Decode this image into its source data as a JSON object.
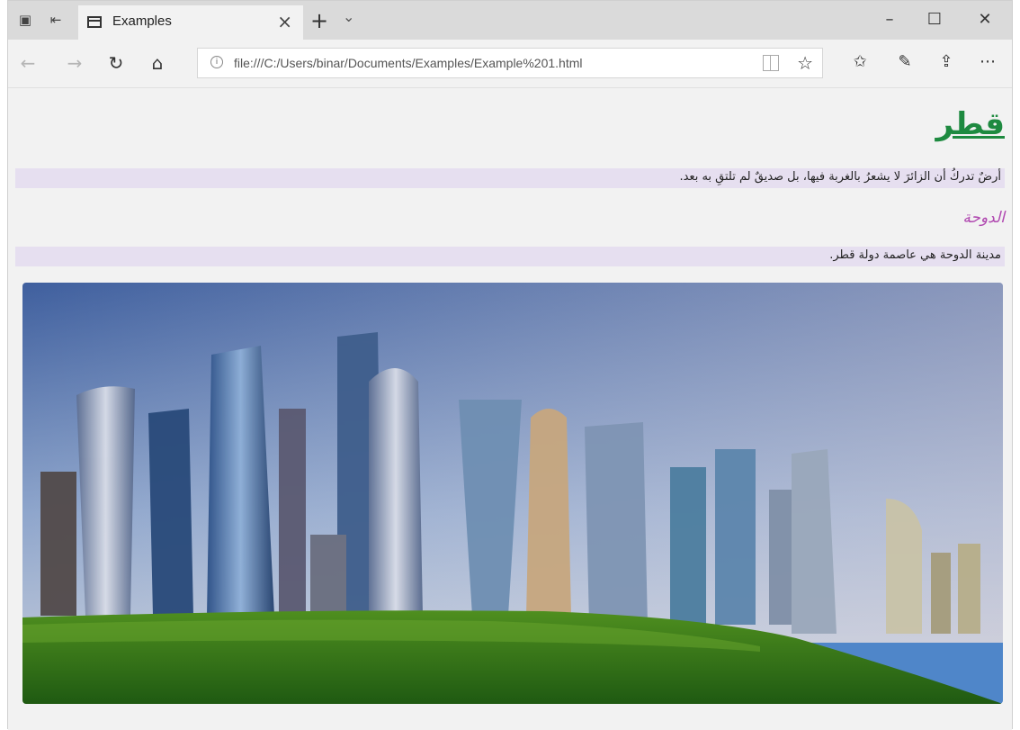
{
  "browser": {
    "tab_title": "Examples",
    "address": "file:///C:/Users/binar/Documents/Examples/Example%201.html",
    "icons": {
      "tab_manager": "tabs-aside-icon",
      "tab_restore": "tabs-restore-icon",
      "tab_page": "page-icon",
      "close_tab": "close-icon",
      "new_tab": "plus-icon",
      "tab_preview": "chevron-down-icon",
      "minimize": "minimize-icon",
      "maximize": "maximize-icon",
      "close_window": "close-icon",
      "back": "back-arrow-icon",
      "forward": "forward-arrow-icon",
      "refresh": "refresh-icon",
      "home": "home-icon",
      "info": "info-icon",
      "reading_view": "book-icon",
      "favorite": "star-icon",
      "favorites_hub": "favorites-list-icon",
      "notes": "pen-icon",
      "share": "share-icon",
      "more": "ellipsis-icon"
    }
  },
  "page": {
    "heading": "قطر",
    "paragraph1": "أرضٌ تدركُ أن الزائرَ لا يشعرُ بالغربة فيها، بل صديقٌ لم تلتقِ به بعد.",
    "subheading": "الدوحة",
    "paragraph2": "مدينة الدوحة هي عاصمة دولة قطر."
  },
  "colors": {
    "heading": "#1e8a40",
    "subheading": "#b048b0",
    "paragraph_band": "#e6dff0"
  }
}
